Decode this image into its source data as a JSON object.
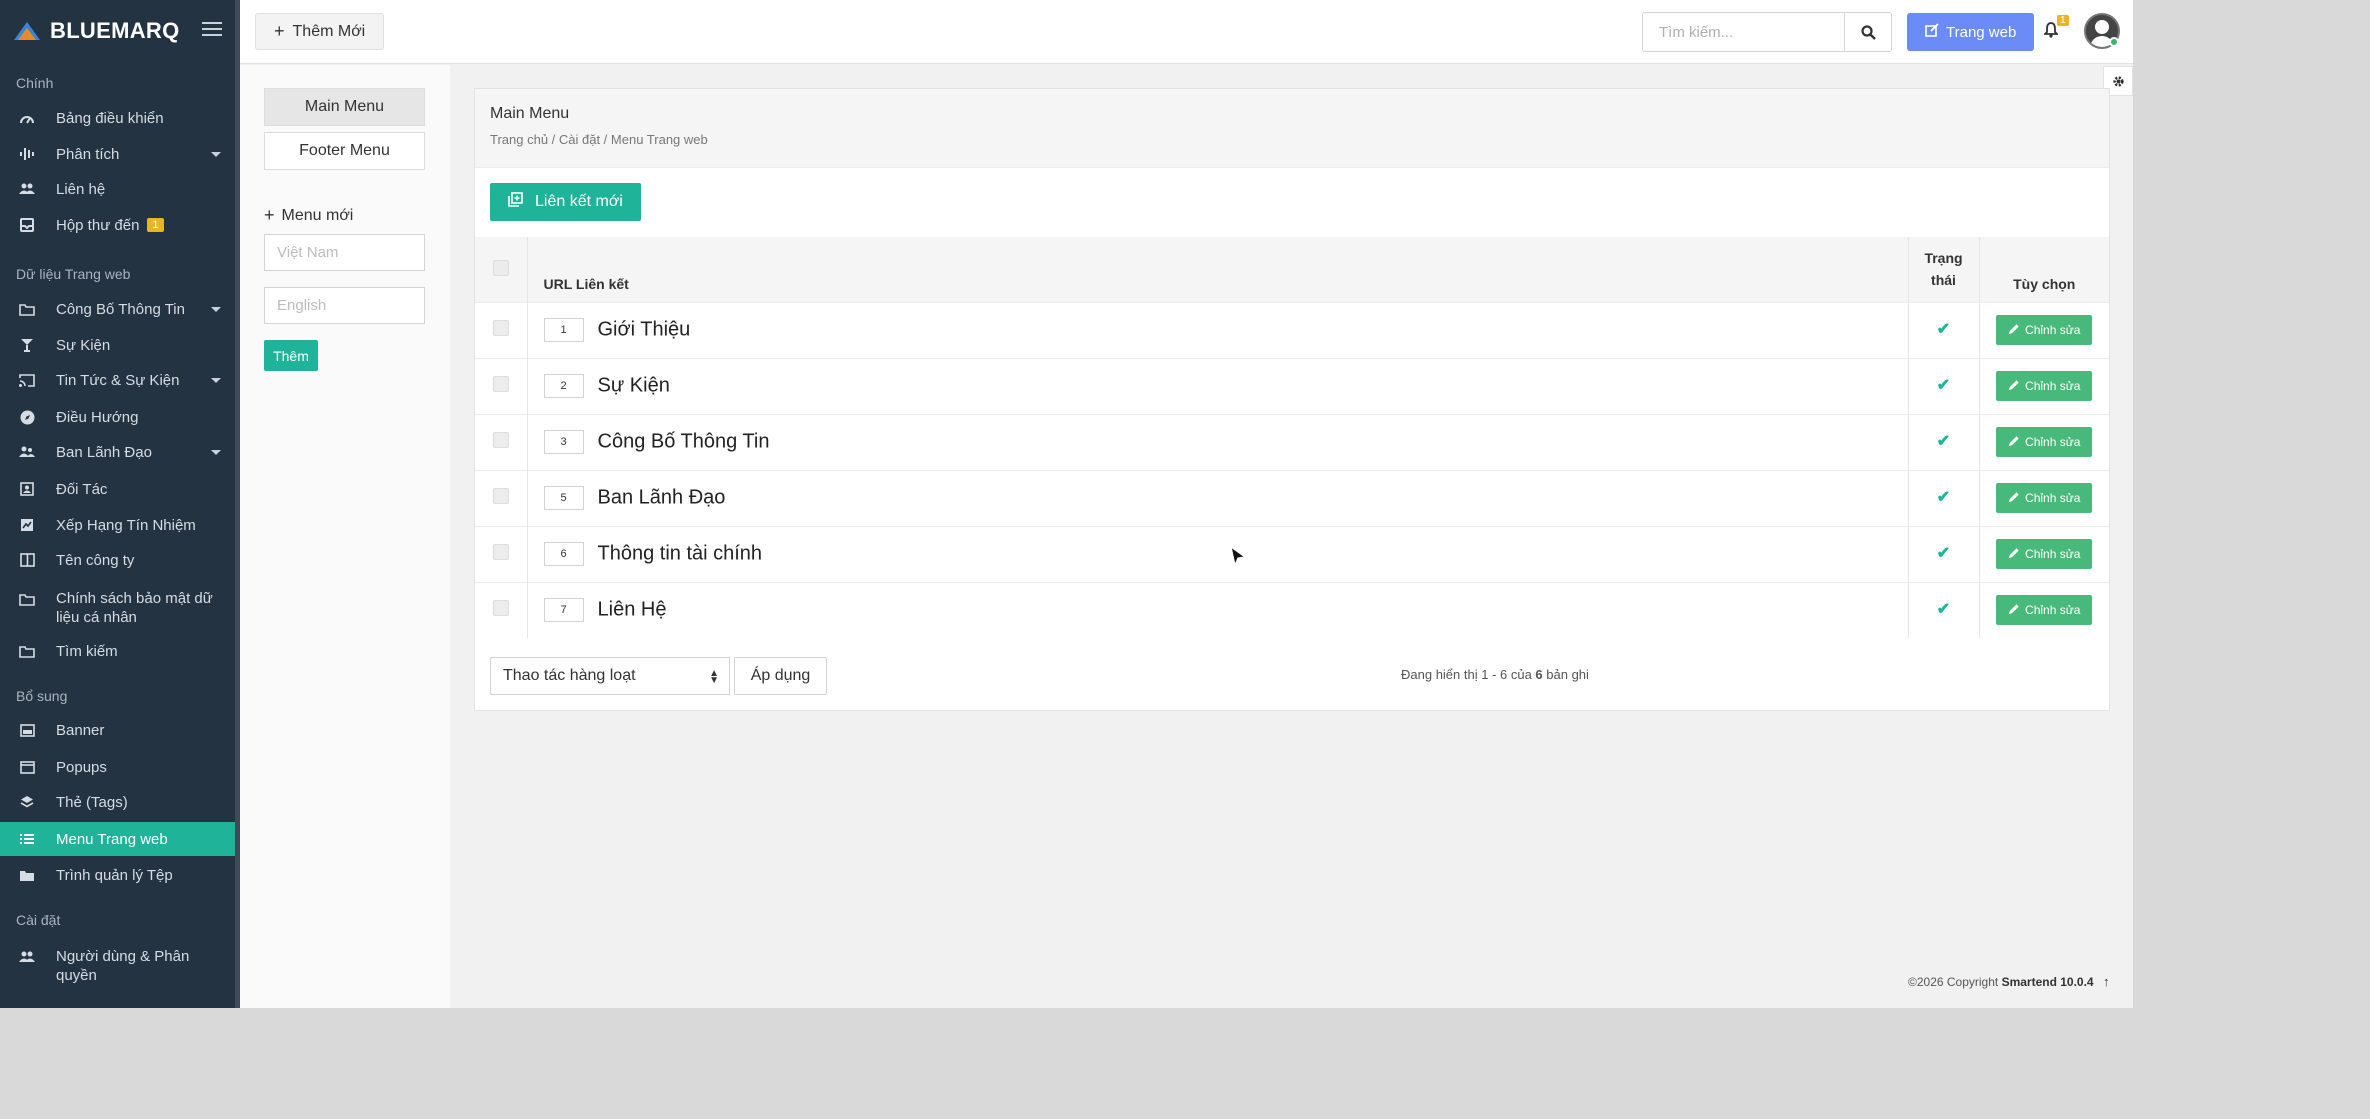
{
  "brand": {
    "name": "BLUEMARQ"
  },
  "sidebar": {
    "sections": [
      {
        "title": "Chính"
      },
      {
        "title": "Dữ liệu Trang web"
      },
      {
        "title": "Bổ sung"
      },
      {
        "title": "Cài đặt"
      }
    ],
    "items": [
      {
        "label": "Bảng điều khiển"
      },
      {
        "label": "Phân tích"
      },
      {
        "label": "Liên hệ"
      },
      {
        "label": "Hộp thư đến",
        "badge": "1"
      },
      {
        "label": "Công Bố Thông Tin"
      },
      {
        "label": "Sự Kiện"
      },
      {
        "label": "Tin Tức & Sự Kiện"
      },
      {
        "label": "Điều Hướng"
      },
      {
        "label": "Ban Lãnh Đạo"
      },
      {
        "label": "Đối Tác"
      },
      {
        "label": "Xếp Hạng Tín Nhiệm"
      },
      {
        "label": "Tên công ty"
      },
      {
        "label": "Chính sách bảo mật dữ liệu cá nhân"
      },
      {
        "label": "Tìm kiếm"
      },
      {
        "label": "Banner"
      },
      {
        "label": "Popups"
      },
      {
        "label": "Thẻ (Tags)"
      },
      {
        "label": "Menu Trang web"
      },
      {
        "label": "Trình quản lý Tệp"
      },
      {
        "label": "Người dùng & Phân quyền"
      }
    ]
  },
  "topbar": {
    "add_new_label": "Thêm Mới",
    "search_placeholder": "Tìm kiếm...",
    "website_button": "Trang web",
    "notification_count": "1"
  },
  "menus": {
    "tabs": [
      {
        "label": "Main Menu"
      },
      {
        "label": "Footer Menu"
      }
    ],
    "new_menu_label": "Menu mới",
    "vietnamese_placeholder": "Việt Nam",
    "english_placeholder": "English",
    "add_button": "Thêm"
  },
  "panel": {
    "title": "Main Menu",
    "breadcrumb": "Trang chủ / Cài đặt / Menu Trang web",
    "new_link_button": "Liên kết mới",
    "columns": {
      "url": "URL Liên kết",
      "status_line1": "Trạng",
      "status_line2": "thái",
      "options": "Tùy chọn"
    },
    "edit_label": "Chỉnh sửa",
    "rows": [
      {
        "order": "1",
        "title": "Giới Thiệu"
      },
      {
        "order": "2",
        "title": "Sự Kiện"
      },
      {
        "order": "3",
        "title": "Công Bố Thông Tin"
      },
      {
        "order": "5",
        "title": "Ban Lãnh Đạo"
      },
      {
        "order": "6",
        "title": "Thông tin tài chính"
      },
      {
        "order": "7",
        "title": "Liên Hệ"
      }
    ],
    "bulk_action": "Thao tác hàng loạt",
    "apply_button": "Áp dụng",
    "records_prefix": "Đang hiển thị 1 - 6 của ",
    "records_total": "6",
    "records_suffix": " bản ghi"
  },
  "footer": {
    "copyright_prefix": "©2026 Copyright ",
    "product": "Smartend 10.0.4"
  },
  "colors": {
    "sidebar_bg": "#243342",
    "accent_teal": "#1fb399",
    "edit_green": "#47b97a",
    "web_button_blue": "#6b8cf7",
    "badge_yellow": "#e8b524"
  }
}
